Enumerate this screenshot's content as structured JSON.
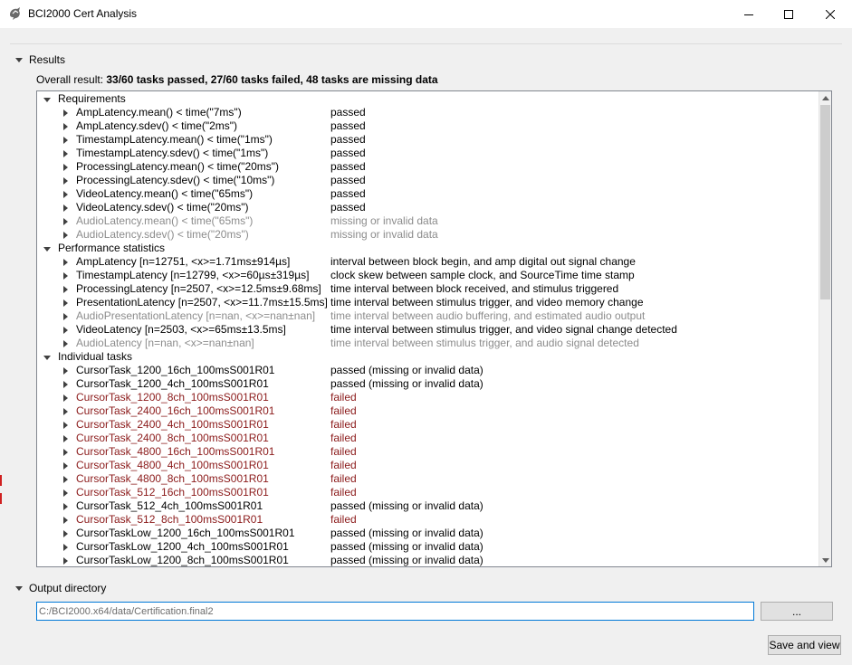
{
  "window": {
    "title": "BCI2000 Cert Analysis",
    "controls": [
      "minimize-icon",
      "maximize-icon",
      "close-icon"
    ]
  },
  "results": {
    "header": "Results",
    "overall_label": "Overall result:",
    "overall_value": "33/60 tasks passed, 27/60 tasks failed, 48 tasks are missing data",
    "groups": [
      {
        "label": "Requirements",
        "items": [
          {
            "name": "AmpLatency.mean() < time(\"7ms\")",
            "value": "passed",
            "status": "ok"
          },
          {
            "name": "AmpLatency.sdev() < time(\"2ms\")",
            "value": "passed",
            "status": "ok"
          },
          {
            "name": "TimestampLatency.mean() < time(\"1ms\")",
            "value": "passed",
            "status": "ok"
          },
          {
            "name": "TimestampLatency.sdev() < time(\"1ms\")",
            "value": "passed",
            "status": "ok"
          },
          {
            "name": "ProcessingLatency.mean() < time(\"20ms\")",
            "value": "passed",
            "status": "ok"
          },
          {
            "name": "ProcessingLatency.sdev() < time(\"10ms\")",
            "value": "passed",
            "status": "ok"
          },
          {
            "name": "VideoLatency.mean() < time(\"65ms\")",
            "value": "passed",
            "status": "ok"
          },
          {
            "name": "VideoLatency.sdev() < time(\"20ms\")",
            "value": "passed",
            "status": "ok"
          },
          {
            "name": "AudioLatency.mean() < time(\"65ms\")",
            "value": "missing or invalid data",
            "status": "missing"
          },
          {
            "name": "AudioLatency.sdev() < time(\"20ms\")",
            "value": "missing or invalid data",
            "status": "missing"
          }
        ]
      },
      {
        "label": "Performance statistics",
        "items": [
          {
            "name": "AmpLatency [n=12751, <x>=1.71ms±914µs]",
            "value": "interval between block begin, and amp digital out signal change",
            "status": "ok"
          },
          {
            "name": "TimestampLatency [n=12799, <x>=60µs±319µs]",
            "value": "clock skew between sample clock, and SourceTime time stamp",
            "status": "ok"
          },
          {
            "name": "ProcessingLatency [n=2507, <x>=12.5ms±9.68ms]",
            "value": "time interval between block received, and stimulus triggered",
            "status": "ok"
          },
          {
            "name": "PresentationLatency [n=2507, <x>=11.7ms±15.5ms]",
            "value": "time interval between stimulus trigger, and video memory change",
            "status": "ok"
          },
          {
            "name": "AudioPresentationLatency [n=nan, <x>=nan±nan]",
            "value": "time interval between audio buffering, and estimated audio output",
            "status": "missing"
          },
          {
            "name": "VideoLatency [n=2503, <x>=65ms±13.5ms]",
            "value": "time interval between stimulus trigger, and video signal change detected",
            "status": "ok"
          },
          {
            "name": "AudioLatency [n=nan, <x>=nan±nan]",
            "value": "time interval between stimulus trigger, and audio signal detected",
            "status": "missing"
          }
        ]
      },
      {
        "label": "Individual tasks",
        "items": [
          {
            "name": "CursorTask_1200_16ch_100msS001R01",
            "value": "passed (missing or invalid data)",
            "status": "ok"
          },
          {
            "name": "CursorTask_1200_4ch_100msS001R01",
            "value": "passed (missing or invalid data)",
            "status": "ok"
          },
          {
            "name": "CursorTask_1200_8ch_100msS001R01",
            "value": "failed",
            "status": "failed"
          },
          {
            "name": "CursorTask_2400_16ch_100msS001R01",
            "value": "failed",
            "status": "failed"
          },
          {
            "name": "CursorTask_2400_4ch_100msS001R01",
            "value": "failed",
            "status": "failed"
          },
          {
            "name": "CursorTask_2400_8ch_100msS001R01",
            "value": "failed",
            "status": "failed"
          },
          {
            "name": "CursorTask_4800_16ch_100msS001R01",
            "value": "failed",
            "status": "failed"
          },
          {
            "name": "CursorTask_4800_4ch_100msS001R01",
            "value": "failed",
            "status": "failed"
          },
          {
            "name": "CursorTask_4800_8ch_100msS001R01",
            "value": "failed",
            "status": "failed"
          },
          {
            "name": "CursorTask_512_16ch_100msS001R01",
            "value": "failed",
            "status": "failed"
          },
          {
            "name": "CursorTask_512_4ch_100msS001R01",
            "value": "passed (missing or invalid data)",
            "status": "ok"
          },
          {
            "name": "CursorTask_512_8ch_100msS001R01",
            "value": "failed",
            "status": "failed"
          },
          {
            "name": "CursorTaskLow_1200_16ch_100msS001R01",
            "value": "passed (missing or invalid data)",
            "status": "ok"
          },
          {
            "name": "CursorTaskLow_1200_4ch_100msS001R01",
            "value": "passed (missing or invalid data)",
            "status": "ok"
          },
          {
            "name": "CursorTaskLow_1200_8ch_100msS001R01",
            "value": "passed (missing or invalid data)",
            "status": "ok"
          }
        ]
      }
    ]
  },
  "output": {
    "header": "Output directory",
    "path_value": "C:/BCI2000.x64/data/Certification.final2",
    "browse_label": "...",
    "save_label": "Save and view"
  },
  "colors": {
    "failed": "#8b1a1a",
    "missing": "#8c8c8c",
    "focus": "#0078d7"
  }
}
